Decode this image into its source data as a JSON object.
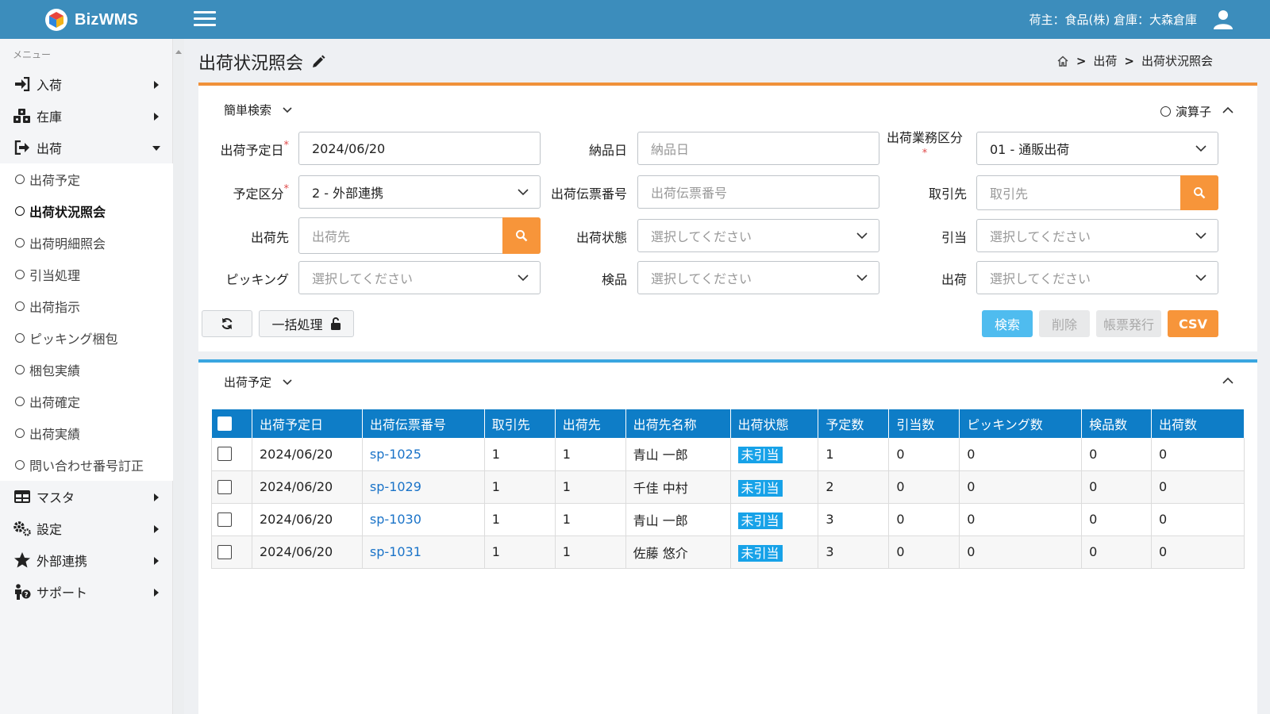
{
  "header": {
    "brand": "BizWMS",
    "shipper_warehouse": "荷主：食品(株) 倉庫：大森倉庫"
  },
  "sidebar": {
    "menu_label": "メニュー",
    "items": [
      {
        "label": "入荷",
        "icon": "sign-in-icon"
      },
      {
        "label": "在庫",
        "icon": "cubes-icon"
      },
      {
        "label": "出荷",
        "icon": "sign-out-icon"
      },
      {
        "label": "マスタ",
        "icon": "table-icon"
      },
      {
        "label": "設定",
        "icon": "gears-icon"
      },
      {
        "label": "外部連携",
        "icon": "star-icon"
      },
      {
        "label": "サポート",
        "icon": "support-person-icon"
      }
    ],
    "sub_items": [
      "出荷予定",
      "出荷状況照会",
      "出荷明細照会",
      "引当処理",
      "出荷指示",
      "ピッキング梱包",
      "梱包実績",
      "出荷確定",
      "出荷実績",
      "問い合わせ番号訂正"
    ]
  },
  "page": {
    "title": "出荷状況照会",
    "breadcrumb": [
      "出荷",
      "出荷状況照会"
    ]
  },
  "search": {
    "heading": "簡単検索",
    "operator_label": "演算子",
    "fields": {
      "ship_date": {
        "label": "出荷予定日",
        "value": "2024/06/20"
      },
      "delivery_date": {
        "label": "納品日",
        "placeholder": "納品日"
      },
      "business_type": {
        "label": "出荷業務区分",
        "value": "01 - 通販出荷"
      },
      "plan_type": {
        "label": "予定区分",
        "value": "2 - 外部連携"
      },
      "slip_no": {
        "label": "出荷伝票番号",
        "placeholder": "出荷伝票番号"
      },
      "partner": {
        "label": "取引先",
        "placeholder": "取引先"
      },
      "destination": {
        "label": "出荷先",
        "placeholder": "出荷先"
      },
      "ship_status": {
        "label": "出荷状態",
        "placeholder": "選択してください"
      },
      "allocation": {
        "label": "引当",
        "placeholder": "選択してください"
      },
      "picking": {
        "label": "ピッキング",
        "placeholder": "選択してください"
      },
      "inspection": {
        "label": "検品",
        "placeholder": "選択してください"
      },
      "shipping": {
        "label": "出荷",
        "placeholder": "選択してください"
      }
    },
    "buttons": {
      "bulk": "一括処理",
      "search": "検索",
      "delete": "削除",
      "report": "帳票発行",
      "csv": "CSV"
    }
  },
  "list": {
    "heading": "出荷予定",
    "columns": [
      "出荷予定日",
      "出荷伝票番号",
      "取引先",
      "出荷先",
      "出荷先名称",
      "出荷状態",
      "予定数",
      "引当数",
      "ピッキング数",
      "検品数",
      "出荷数"
    ],
    "rows": [
      [
        "2024/06/20",
        "sp-1025",
        "1",
        "1",
        "青山 一郎",
        "未引当",
        "1",
        "0",
        "0",
        "0",
        "0"
      ],
      [
        "2024/06/20",
        "sp-1029",
        "1",
        "1",
        "千佳 中村",
        "未引当",
        "2",
        "0",
        "0",
        "0",
        "0"
      ],
      [
        "2024/06/20",
        "sp-1030",
        "1",
        "1",
        "青山 一郎",
        "未引当",
        "3",
        "0",
        "0",
        "0",
        "0"
      ],
      [
        "2024/06/20",
        "sp-1031",
        "1",
        "1",
        "佐藤 悠介",
        "未引当",
        "3",
        "0",
        "0",
        "0",
        "0"
      ]
    ]
  }
}
